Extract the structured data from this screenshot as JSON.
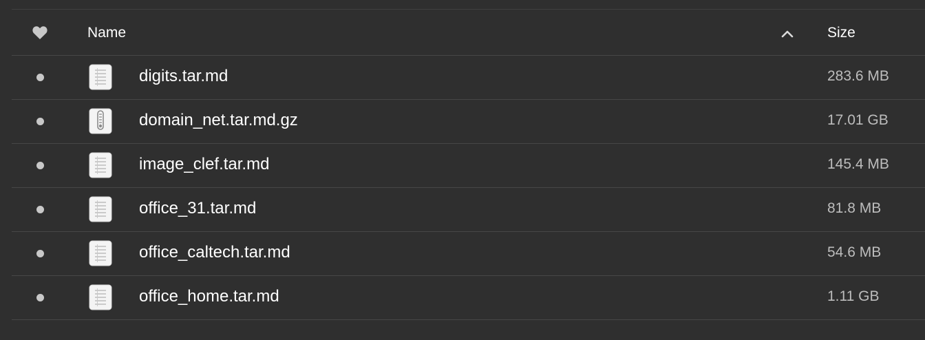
{
  "header": {
    "name_label": "Name",
    "size_label": "Size",
    "favorite_icon": "heart-icon",
    "sort_icon": "chevron-up-icon"
  },
  "colors": {
    "background": "#2f2f2f",
    "divider": "#474747",
    "text_primary": "#ffffff",
    "text_secondary": "#bdbdbd"
  },
  "files": [
    {
      "name": "digits.tar.md",
      "size": "283.6 MB",
      "icon": "text-file-icon"
    },
    {
      "name": "domain_net.tar.md.gz",
      "size": "17.01 GB",
      "icon": "archive-file-icon"
    },
    {
      "name": "image_clef.tar.md",
      "size": "145.4 MB",
      "icon": "text-file-icon"
    },
    {
      "name": "office_31.tar.md",
      "size": "81.8 MB",
      "icon": "text-file-icon"
    },
    {
      "name": "office_caltech.tar.md",
      "size": "54.6 MB",
      "icon": "text-file-icon"
    },
    {
      "name": "office_home.tar.md",
      "size": "1.11 GB",
      "icon": "text-file-icon"
    }
  ]
}
